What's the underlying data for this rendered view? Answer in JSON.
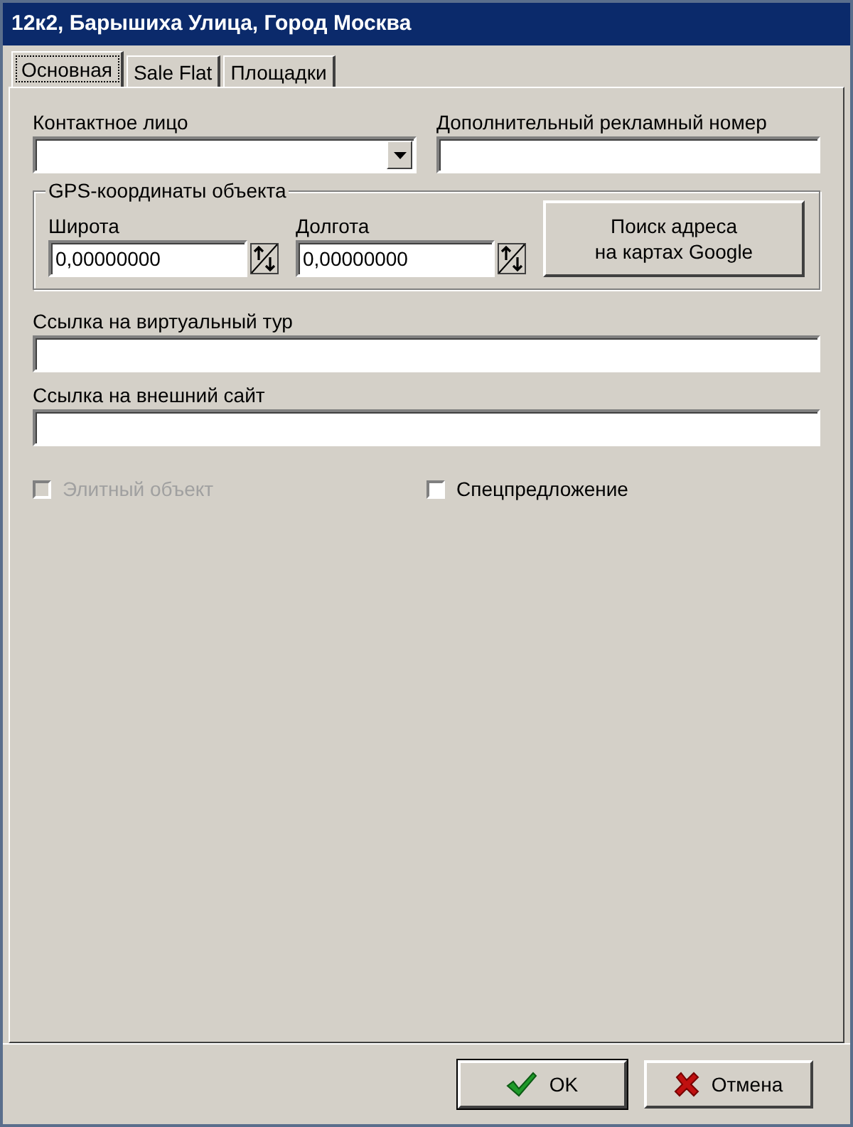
{
  "window": {
    "title": "12к2, Барышиха Улица, Город Москва"
  },
  "tabs": [
    {
      "label": "Основная",
      "selected": true
    },
    {
      "label": "Sale Flat",
      "selected": false
    },
    {
      "label": "Площадки",
      "selected": false
    }
  ],
  "contact_person": {
    "label": "Контактное лицо"
  },
  "ad_number": {
    "label": "Дополнительный рекламный номер"
  },
  "gps": {
    "legend": "GPS-координаты объекта",
    "latitude": {
      "label": "Широта",
      "value": "0,00000000"
    },
    "longitude": {
      "label": "Долгота",
      "value": "0,00000000"
    },
    "search_button": "Поиск адреса\nна картах Google"
  },
  "virtual_tour": {
    "label": "Ссылка на виртуальный тур"
  },
  "external_site": {
    "label": "Ссылка на внешний сайт"
  },
  "checkboxes": [
    {
      "label": "Элитный объект",
      "checked": false,
      "disabled": true
    },
    {
      "label": "Спецпредложение",
      "checked": false,
      "disabled": false
    }
  ],
  "buttons": [
    {
      "label": "OK",
      "kind": "ok"
    },
    {
      "label": "Отмена",
      "kind": "cancel"
    }
  ]
}
